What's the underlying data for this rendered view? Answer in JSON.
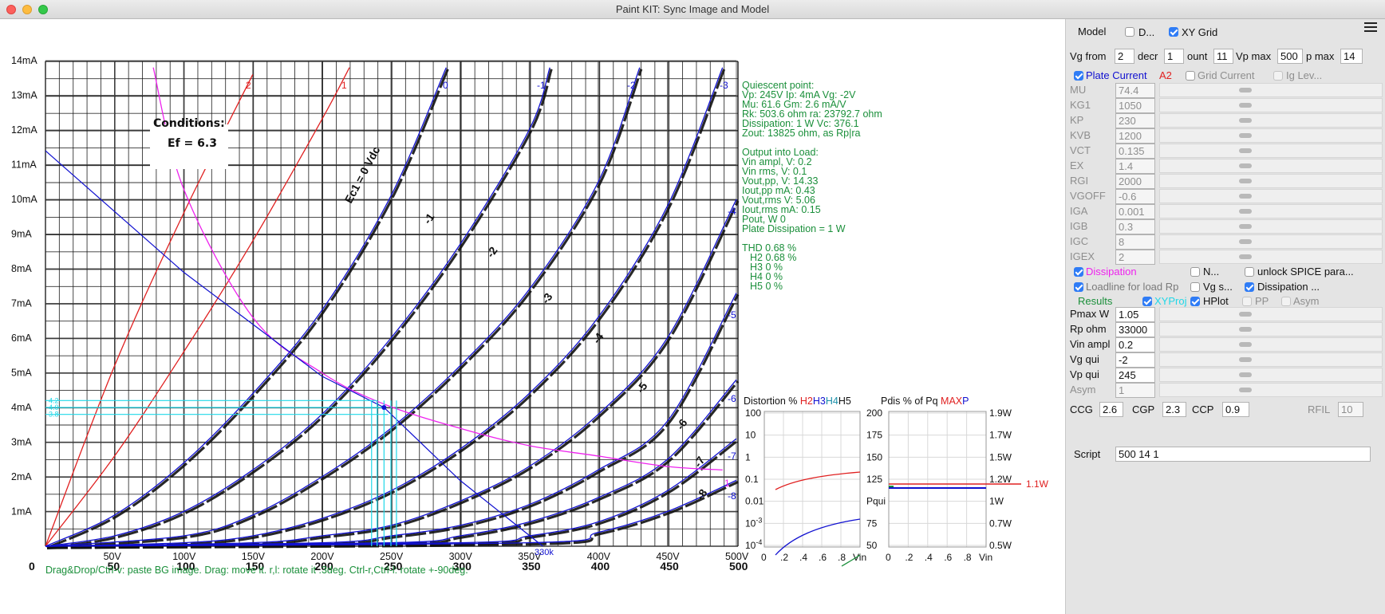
{
  "window": {
    "title": "Paint KIT: Sync Image and Model"
  },
  "status_hint": "Drag&Drop/Ctrl-v: paste BG image. Drag: move it. r,l: rotate it .3deg. Ctrl-r,Ctrl-l: rotate +-90deg.",
  "colors": {
    "accent": "#2f7cf6",
    "green_text": "#1a8f3a",
    "red": "#e02020",
    "blue": "#1010d0",
    "magenta": "#ee22ee",
    "cyan": "#20d8e8"
  },
  "plot": {
    "y_tick_labels": [
      "14mA",
      "13mA",
      "12mA",
      "11mA",
      "10mA",
      "9mA",
      "8mA",
      "7mA",
      "6mA",
      "5mA",
      "4mA",
      "3mA",
      "2mA",
      "1mA"
    ],
    "x_tick_labels_model": [
      "50V",
      "100V",
      "150V",
      "200V",
      "250V",
      "300V",
      "350V",
      "400V",
      "450V",
      "500V"
    ],
    "x_tick_labels_scan": [
      "0",
      "50",
      "100",
      "150",
      "200",
      "250",
      "300",
      "350",
      "400",
      "450",
      "500"
    ],
    "curve_labels": [
      "2",
      "1",
      "0",
      "-1",
      "-2",
      "-3",
      "-4",
      "-5",
      "-6",
      "-7",
      "-8"
    ],
    "scan_labels": {
      "ec": "Ec1 = 0 Vdc",
      "minus1": "-1",
      "minus2": "-2",
      "minus3": "-3",
      "minus4": "-4",
      "minus5": "-5",
      "minus6": "-6",
      "minus7": "-7",
      "minus8": "-8"
    },
    "conditions": {
      "title": "Conditions:",
      "ef": "Ef = 6.3"
    },
    "dissipation_label": "1",
    "loadline_label": "Rp",
    "small_blue_label": "330k",
    "cyan_labels": [
      "4.2",
      "4.0",
      "3.8"
    ]
  },
  "info": {
    "quiescent": [
      "Quiescent point:",
      "Vp: 245V  Ip: 4mA  Vg: -2V",
      "Mu: 61.6 Gm: 2.6 mA/V",
      "Rk: 503.6 ohm ra: 23792.7 ohm",
      "Dissipation: 1 W Vc: 376.1",
      "Zout: 13825 ohm, as Rp|ra"
    ],
    "output": [
      "Output into Load:",
      "Vin ampl, V: 0.2",
      "Vin rms,  V: 0.1",
      "Vout,pp,   V: 14.33",
      "Iout,pp   mA: 0.43",
      "Vout,rms   V: 5.06",
      "Iout,rms  mA: 0.15",
      "Pout, W       0",
      "Plate Dissipation = 1 W"
    ],
    "thd": [
      "THD 0.68 %",
      "H2 0.68 %",
      "H3 0 %",
      "H4 0 %",
      "H5 0 %"
    ]
  },
  "distortion_chart": {
    "title_parts": [
      "Distortion % ",
      "H2",
      "H3",
      "H4",
      "H5"
    ],
    "y_ticks": [
      "100",
      "10",
      "1",
      "0.1",
      "0.01",
      "10^-3",
      "10^-4"
    ],
    "x_ticks": [
      "0",
      ".2",
      ".4",
      ".6",
      ".8"
    ],
    "x_label": "Vin"
  },
  "pdis_chart": {
    "title_parts": [
      "Pdis % of Pq ",
      "MAX",
      "P"
    ],
    "y_ticks_left": [
      "200",
      "175",
      "150",
      "125",
      "Pqui",
      "75",
      "50"
    ],
    "y_ticks_right": [
      "1.9W",
      "1.7W",
      "1.5W",
      "1.2W",
      "1W",
      "0.7W",
      "0.5W"
    ],
    "x_ticks": [
      "0",
      ".2",
      ".4",
      ".6",
      ".8"
    ],
    "x_label": "Vin",
    "max_label": "1.1W"
  },
  "chart_data": {
    "type": "line",
    "title": "",
    "xlabel": "",
    "ylabel": "",
    "xlim": [
      0,
      500
    ],
    "ylim": [
      0,
      14
    ],
    "grid": true,
    "series": [
      {
        "name": "2",
        "x": [
          0,
          50,
          100,
          150
        ],
        "y": [
          0,
          5.2,
          9.6,
          13.6
        ]
      },
      {
        "name": "1",
        "x": [
          0,
          50,
          100,
          150,
          200,
          220
        ],
        "y": [
          0,
          2.6,
          5.6,
          8.8,
          12.3,
          13.8
        ]
      },
      {
        "name": "0",
        "x": [
          0,
          50,
          100,
          150,
          200,
          250,
          290
        ],
        "y": [
          0,
          0.9,
          2.4,
          4.4,
          6.8,
          10.1,
          13.8
        ]
      },
      {
        "name": "-1",
        "x": [
          0,
          50,
          100,
          150,
          200,
          250,
          300,
          350,
          365
        ],
        "y": [
          0,
          0.3,
          1.0,
          2.2,
          3.8,
          6.0,
          8.7,
          12.0,
          13.8
        ]
      },
      {
        "name": "-2",
        "x": [
          0,
          100,
          150,
          200,
          250,
          300,
          350,
          400,
          430
        ],
        "y": [
          0,
          0.3,
          0.9,
          2.0,
          3.4,
          5.2,
          7.4,
          10.5,
          13.8
        ]
      },
      {
        "name": "-3",
        "x": [
          0,
          100,
          150,
          200,
          250,
          300,
          350,
          400,
          450,
          490
        ],
        "y": [
          0,
          0.1,
          0.3,
          0.8,
          1.6,
          2.8,
          4.4,
          6.6,
          9.8,
          13.8
        ]
      },
      {
        "name": "-4",
        "x": [
          0,
          150,
          200,
          250,
          300,
          350,
          400,
          450,
          500
        ],
        "y": [
          0,
          0.1,
          0.3,
          0.6,
          1.3,
          2.3,
          3.8,
          6.0,
          10.0
        ]
      },
      {
        "name": "-5",
        "x": [
          0,
          200,
          250,
          300,
          350,
          400,
          450,
          500
        ],
        "y": [
          0,
          0.1,
          0.3,
          0.6,
          1.2,
          2.2,
          3.6,
          7.3
        ]
      },
      {
        "name": "-6",
        "x": [
          0,
          250,
          300,
          350,
          400,
          450,
          500
        ],
        "y": [
          0,
          0.1,
          0.3,
          0.7,
          1.4,
          2.5,
          4.8
        ]
      },
      {
        "name": "-7",
        "x": [
          0,
          300,
          350,
          400,
          450,
          500
        ],
        "y": [
          0,
          0.1,
          0.3,
          0.7,
          1.6,
          3.1
        ]
      },
      {
        "name": "-8",
        "x": [
          0,
          350,
          400,
          450,
          500
        ],
        "y": [
          0,
          0.1,
          0.4,
          1.0,
          1.9
        ]
      },
      {
        "name": "1",
        "x": [
          78,
          100,
          150,
          200,
          245,
          300,
          350,
          400,
          450,
          490
        ],
        "y": [
          13.8,
          10.3,
          6.6,
          5.0,
          4.1,
          3.4,
          2.9,
          2.6,
          2.3,
          2.2
        ]
      },
      {
        "name": "Rp",
        "x": [
          0,
          100,
          200,
          245,
          300,
          360
        ],
        "y": [
          11.4,
          7.9,
          4.9,
          4.0,
          1.9,
          0
        ]
      }
    ]
  },
  "panel": {
    "model_label": "Model",
    "d_label": "D...",
    "xygrid_label": "XY Grid",
    "vg_from_label": "Vg from",
    "vg_from_value": "2",
    "decr_label": "decr",
    "decr_value": "1",
    "count_label": "ount",
    "count_value": "11",
    "vpmax_label": "Vp max",
    "vpmax_value": "500",
    "pmax_label": "p max",
    "pmax_value": "14",
    "plate_current_label": "Plate Current",
    "a2_label": "A2",
    "grid_current_label": "Grid Current",
    "ig_lev_label": "Ig Lev...",
    "params": [
      {
        "name": "MU",
        "value": "74.4"
      },
      {
        "name": "KG1",
        "value": "1050"
      },
      {
        "name": "KP",
        "value": "230"
      },
      {
        "name": "KVB",
        "value": "1200"
      },
      {
        "name": "VCT",
        "value": "0.135"
      },
      {
        "name": "EX",
        "value": "1.4"
      },
      {
        "name": "RGI",
        "value": "2000"
      },
      {
        "name": "VGOFF",
        "value": "-0.6"
      },
      {
        "name": "IGA",
        "value": "0.001"
      },
      {
        "name": "IGB",
        "value": "0.3"
      },
      {
        "name": "IGC",
        "value": "8"
      },
      {
        "name": "IGEX",
        "value": "2"
      }
    ],
    "dissipation_label": "Dissipation",
    "n_label": "N...",
    "unlock_label": "unlock SPICE para...",
    "loadline_label": "Loadline for load Rp",
    "vgs_label": "Vg s...",
    "dissipation2_label": "Dissipation ...",
    "results_label": "Results",
    "xyproj_label": "XYProj",
    "hplot_label": "HPlot",
    "pp_label": "PP",
    "asym_cb_label": "Asym",
    "results": [
      {
        "name": "Pmax W",
        "value": "1.05",
        "enabled": true
      },
      {
        "name": "Rp ohm",
        "value": "33000",
        "enabled": true
      },
      {
        "name": "Vin ampl",
        "value": "0.2",
        "enabled": true
      },
      {
        "name": "Vg qui",
        "value": "-2",
        "enabled": true
      },
      {
        "name": "Vp qui",
        "value": "245",
        "enabled": true
      },
      {
        "name": "Asym",
        "value": "1",
        "enabled": false
      }
    ],
    "ccg_label": "CCG",
    "ccg_value": "2.6",
    "cgp_label": "CGP",
    "cgp_value": "2.3",
    "ccp_label": "CCP",
    "ccp_value": "0.9",
    "rfil_label": "RFIL",
    "rfil_value": "10",
    "script_label": "Script",
    "script_value": "500 14 1"
  }
}
